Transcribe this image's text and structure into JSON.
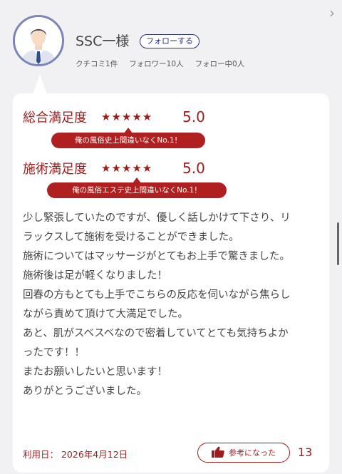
{
  "user": {
    "name": "SSC一様",
    "follow_label": "フォローする",
    "stats": [
      "クチコミ1件",
      "フォロワー10人",
      "フォロー中0人"
    ]
  },
  "ratings": [
    {
      "label": "総合満足度",
      "stars": "★★★★★",
      "score": "5.0",
      "tag": "俺の風俗史上間違いなくNo.1！"
    },
    {
      "label": "施術満足度",
      "stars": "★★★★★",
      "score": "5.0",
      "tag": "俺の風俗エステ史上間違いなくNo.1！"
    }
  ],
  "review_lines": [
    "少し緊張していたのですが、優しく話しかけて下さり、リ",
    "ラックスして施術を受けることができました。",
    "施術についてはマッサージがとてもお上手で驚きました。",
    "施術後は足が軽くなりました！",
    "回春の方もとても上手でこちらの反応を伺いながら焦らし",
    "ながら責めて頂けて大満足でした。",
    "あと、肌がスベスベなので密着していてとても気持ちよか",
    "ったです！！",
    "またお願いしたいと思います！",
    "ありがとうございました。"
  ],
  "footer": {
    "date": "利用日：  2026年4月12日",
    "helpful_label": "参考になった",
    "helpful_count": "13"
  },
  "colors": {
    "accent": "#9c1c1c",
    "tag_bg": "#b02020",
    "follow": "#2a2f7a",
    "avatar_ring": "#7d84b8"
  },
  "icons": {
    "chevron": "chevron-right-icon",
    "thumb": "thumbs-up-icon"
  }
}
